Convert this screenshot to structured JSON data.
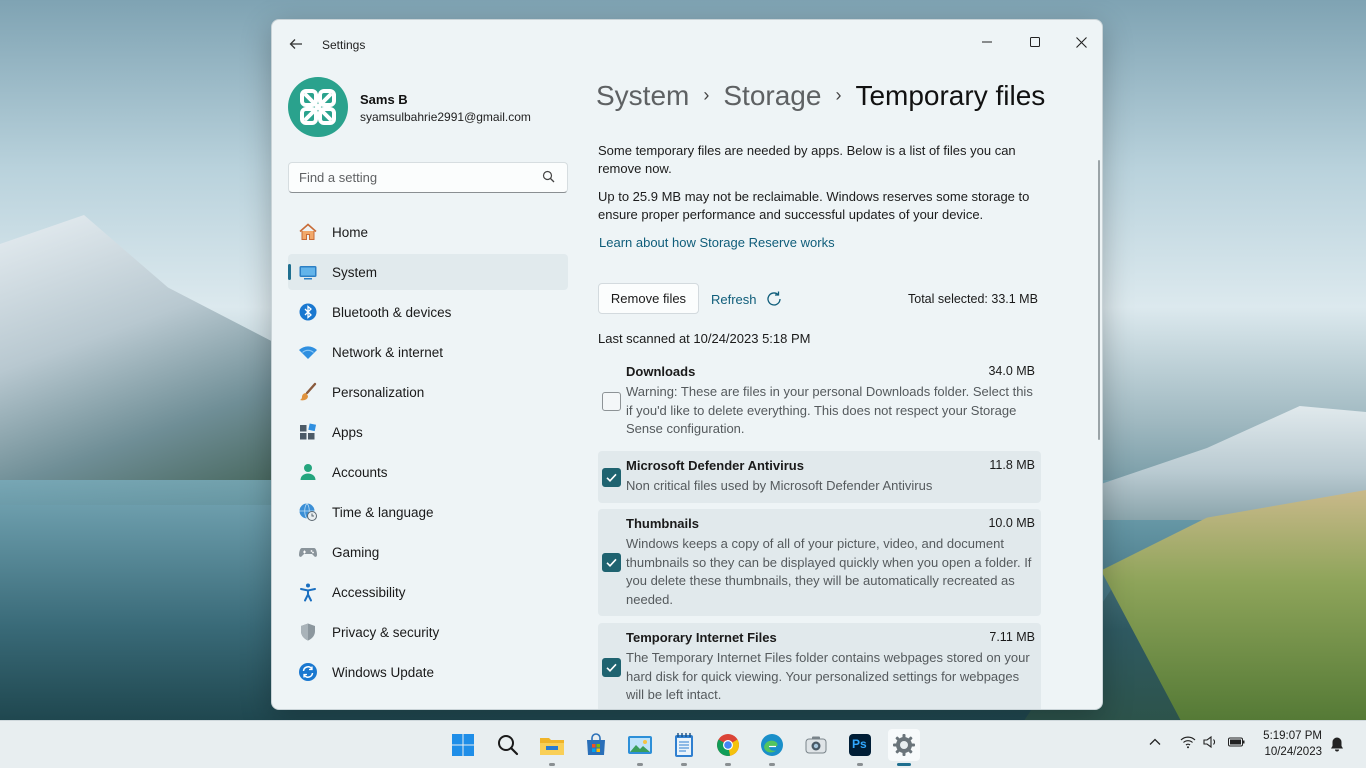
{
  "window": {
    "app_title": "Settings",
    "controls": {
      "minimize": "—",
      "maximize": "▢",
      "close": "✕"
    }
  },
  "user": {
    "name": "Sams B",
    "email": "syamsulbahrie2991@gmail.com"
  },
  "search": {
    "placeholder": "Find a setting"
  },
  "sidebar": {
    "items": [
      {
        "label": "Home",
        "icon": "home-icon",
        "selected": false
      },
      {
        "label": "System",
        "icon": "system-icon",
        "selected": true
      },
      {
        "label": "Bluetooth & devices",
        "icon": "bluetooth-icon",
        "selected": false
      },
      {
        "label": "Network & internet",
        "icon": "network-icon",
        "selected": false
      },
      {
        "label": "Personalization",
        "icon": "brush-icon",
        "selected": false
      },
      {
        "label": "Apps",
        "icon": "apps-icon",
        "selected": false
      },
      {
        "label": "Accounts",
        "icon": "accounts-icon",
        "selected": false
      },
      {
        "label": "Time & language",
        "icon": "globe-clock-icon",
        "selected": false
      },
      {
        "label": "Gaming",
        "icon": "gamepad-icon",
        "selected": false
      },
      {
        "label": "Accessibility",
        "icon": "accessibility-icon",
        "selected": false
      },
      {
        "label": "Privacy & security",
        "icon": "shield-icon",
        "selected": false
      },
      {
        "label": "Windows Update",
        "icon": "update-icon",
        "selected": false
      }
    ]
  },
  "breadcrumb": {
    "parts": [
      "System",
      "Storage",
      "Temporary files"
    ],
    "separator": "›"
  },
  "content": {
    "intro": "Some temporary files are needed by apps. Below is a list of files you can remove now.",
    "reserve_note": "Up to 25.9 MB may not be reclaimable. Windows reserves some storage to ensure proper performance and successful updates of your device.",
    "reserve_link": "Learn about how Storage Reserve works",
    "remove_button": "Remove files",
    "refresh_button": "Refresh",
    "total_selected": "Total selected: 33.1 MB",
    "last_scanned": "Last scanned at 10/24/2023 5:18 PM"
  },
  "files": [
    {
      "title": "Downloads",
      "size": "34.0 MB",
      "checked": false,
      "description": "Warning: These are files in your personal Downloads folder. Select this if you'd like to delete everything. This does not respect your Storage Sense configuration."
    },
    {
      "title": "Microsoft Defender Antivirus",
      "size": "11.8 MB",
      "checked": true,
      "description": "Non critical files used by Microsoft Defender Antivirus"
    },
    {
      "title": "Thumbnails",
      "size": "10.0 MB",
      "checked": true,
      "description": "Windows keeps a copy of all of your picture, video, and document thumbnails so they can be displayed quickly when you open a folder. If you delete these thumbnails, they will be automatically recreated as needed."
    },
    {
      "title": "Temporary Internet Files",
      "size": "7.11 MB",
      "checked": true,
      "description": "The Temporary Internet Files folder contains webpages stored on your hard disk for quick viewing. Your personalized settings for webpages will be left intact."
    }
  ],
  "taskbar": {
    "apps": [
      {
        "name": "start-icon"
      },
      {
        "name": "search-icon"
      },
      {
        "name": "file-explorer-icon"
      },
      {
        "name": "store-icon"
      },
      {
        "name": "photos-icon"
      },
      {
        "name": "notepad-icon"
      },
      {
        "name": "chrome-icon"
      },
      {
        "name": "edge-icon"
      },
      {
        "name": "camera-icon"
      },
      {
        "name": "photoshop-icon",
        "text": "Ps"
      },
      {
        "name": "settings-icon",
        "active": true
      }
    ],
    "time": "5:19:07 PM",
    "date": "10/24/2023"
  },
  "colors": {
    "accent": "#1f6f8f",
    "checkbox": "#1f6370",
    "link": "#0f5d7a"
  }
}
